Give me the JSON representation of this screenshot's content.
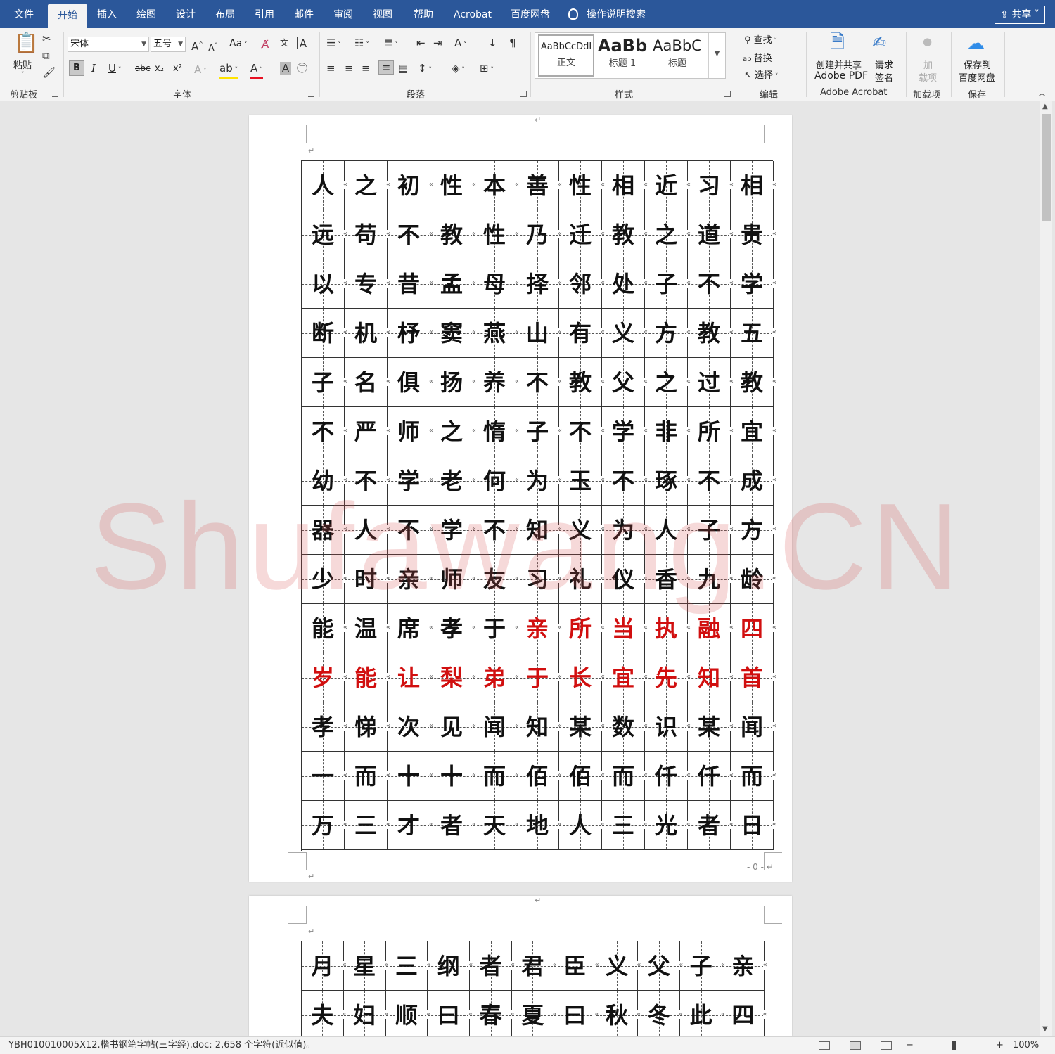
{
  "tabs": [
    "文件",
    "开始",
    "插入",
    "绘图",
    "设计",
    "布局",
    "引用",
    "邮件",
    "审阅",
    "视图",
    "帮助",
    "Acrobat",
    "百度网盘"
  ],
  "active_tab": "开始",
  "search_label": "操作说明搜索",
  "share_label": "共享",
  "ribbon": {
    "clipboard": {
      "paste": "粘贴",
      "label": "剪贴板"
    },
    "font": {
      "name": "宋体",
      "size": "五号",
      "case_label": "Aa",
      "bold": "B",
      "italic": "I",
      "underline": "U",
      "strike": "abc",
      "subscript": "x₂",
      "superscript": "x²",
      "label": "字体"
    },
    "paragraph": {
      "label": "段落"
    },
    "styles": {
      "items": [
        {
          "preview": "AaBbCcDdI",
          "name": "正文"
        },
        {
          "preview": "AaBb",
          "name": "标题 1"
        },
        {
          "preview": "AaBbC",
          "name": "标题"
        }
      ],
      "label": "样式"
    },
    "editing": {
      "find": "查找",
      "replace": "替换",
      "select": "选择",
      "label": "编辑"
    },
    "acrobat": {
      "create_line1": "创建并共享",
      "create_line2": "Adobe PDF",
      "sign_line1": "请求",
      "sign_line2": "签名",
      "label": "Adobe Acrobat"
    },
    "addins": {
      "line1": "加",
      "line2": "载项",
      "label": "加载项"
    },
    "save": {
      "line1": "保存到",
      "line2": "百度网盘",
      "label": "保存"
    }
  },
  "page1_rows": [
    "人之初性本善性相近习相",
    "远苟不教性乃迁教之道贵",
    "以专昔孟母择邻处子不学",
    "断机杼窦燕山有义方教五",
    "子名俱扬养不教父之过教",
    "不严师之惰子不学非所宜",
    "幼不学老何为玉不琢不成",
    "器人不学不知义为人子方",
    "少时亲师友习礼仪香九龄",
    "能温席孝于亲所当执融四",
    "岁能让梨弟于长宜先知首",
    "孝悌次见闻知某数识某闻",
    "一而十十而佰佰而仟仟而",
    "万三才者天地人三光者日"
  ],
  "page1_red": [
    [],
    [],
    [],
    [],
    [],
    [],
    [],
    [],
    [],
    [
      5,
      6,
      7,
      8,
      9,
      10
    ],
    [
      0,
      1,
      2,
      3,
      4,
      5,
      6,
      7,
      8,
      9,
      10
    ],
    [],
    [],
    []
  ],
  "page2_rows": [
    "月星三纲者君臣义父子亲",
    "夫妇顺曰春夏曰秋冬此四"
  ],
  "page_number": "- 0 -",
  "watermark": "Shufawang.CN",
  "status_text": "YBH010010005X12.楷书钢笔字帖(三字经).doc: 2,658 个字符(近似值)。",
  "zoom_level": "100%",
  "colors": {
    "ribbon_blue": "#2b579a",
    "red_char": "#d10f0f"
  }
}
